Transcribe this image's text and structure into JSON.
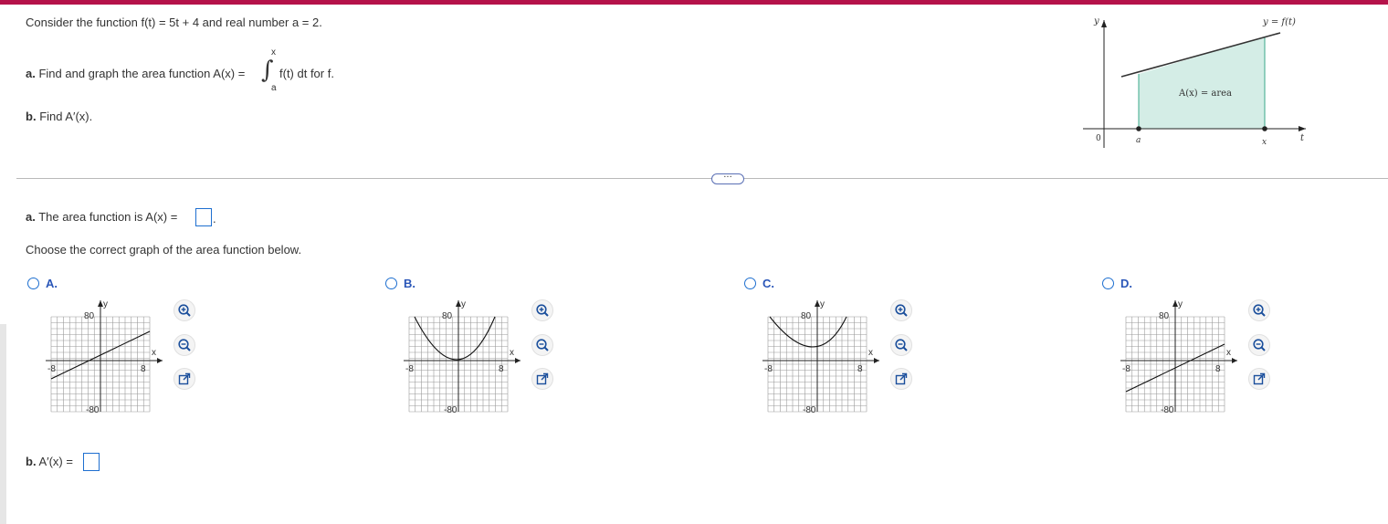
{
  "problem": {
    "statement": "Consider the function f(t) = 5t + 4 and real number a = 2.",
    "part_a_prefix": "a.",
    "part_a_text": "Find and graph the area function A(x) =",
    "integral_upper": "x",
    "integral_lower": "a",
    "integral_body": "f(t) dt for f.",
    "part_b_prefix": "b.",
    "part_b_text": "Find A′(x)."
  },
  "figure": {
    "y_axis": "y",
    "t_axis": "t",
    "origin": "0",
    "a_label": "a",
    "x_label": "x",
    "curve_label": "y = f(t)",
    "area_label": "A(x) = area"
  },
  "more_button": "···",
  "answer": {
    "a_prefix": "a.",
    "a_text": "The area function is A(x) =",
    "a_suffix": ".",
    "choose_text": "Choose the correct graph of the area function below.",
    "b_prefix": "b.",
    "b_text": "A′(x) ="
  },
  "options": [
    {
      "label": "A.",
      "curve": "line-up"
    },
    {
      "label": "B.",
      "curve": "parabola-low"
    },
    {
      "label": "C.",
      "curve": "parabola-high"
    },
    {
      "label": "D.",
      "curve": "line-low"
    }
  ],
  "graph_labels": {
    "y": "y",
    "x": "x",
    "ytop": "80",
    "ybot": "-80",
    "xleft": "-8",
    "xright": "8"
  },
  "colors": {
    "accent": "#b5124a",
    "link": "#1e6fd0",
    "shade": "#d4ede6"
  }
}
